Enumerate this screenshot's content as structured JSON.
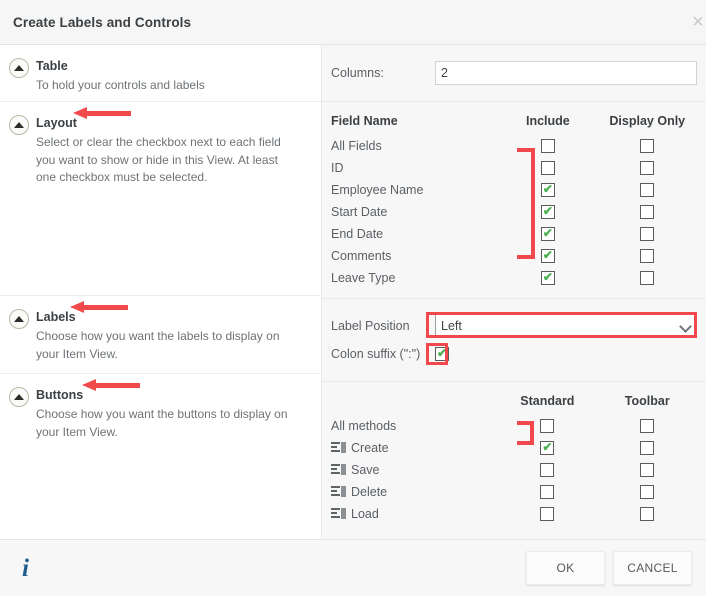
{
  "window": {
    "title": "Create Labels and Controls",
    "close_icon": "close-icon",
    "close_glyph": "×"
  },
  "sections": [
    {
      "key": "table",
      "title": "Table",
      "description": "To hold your controls and labels",
      "has_arrow": false,
      "collapse_icon": "collapse-up-icon"
    },
    {
      "key": "layout",
      "title": "Layout",
      "description": "Select or clear the checkbox next to each field you want to show or hide in this View. At least one checkbox must be selected.",
      "has_arrow": true,
      "collapse_icon": "collapse-up-icon"
    },
    {
      "key": "labels",
      "title": "Labels",
      "description": "Choose how you want the labels to display on your Item View.",
      "has_arrow": true,
      "collapse_icon": "collapse-up-icon"
    },
    {
      "key": "buttons",
      "title": "Buttons",
      "description": "Choose how you want the buttons to display on your Item View.",
      "has_arrow": true,
      "collapse_icon": "collapse-up-icon"
    }
  ],
  "table_panel": {
    "columns_label": "Columns:",
    "columns_value": "2",
    "columns_placeholder": ""
  },
  "layout_panel": {
    "headers": [
      "Field Name",
      "Include",
      "Display Only"
    ],
    "rows": [
      {
        "name": "All Fields",
        "include": false,
        "display_only": false
      },
      {
        "name": "ID",
        "include": false,
        "display_only": false
      },
      {
        "name": "Employee Name",
        "include": true,
        "display_only": false
      },
      {
        "name": "Start Date",
        "include": true,
        "display_only": false
      },
      {
        "name": "End Date",
        "include": true,
        "display_only": false
      },
      {
        "name": "Comments",
        "include": true,
        "display_only": false
      },
      {
        "name": "Leave Type",
        "include": true,
        "display_only": false
      }
    ]
  },
  "labels_panel": {
    "position_label": "Label Position",
    "position_value": "Left",
    "position_options": [
      "Left"
    ],
    "colon_label": "Colon suffix (\":\")",
    "colon_checked": true,
    "chevron_icon": "chevron-down-icon"
  },
  "buttons_panel": {
    "headers": [
      "",
      "Standard",
      "Toolbar"
    ],
    "rows": [
      {
        "name": "All methods",
        "icon": false,
        "standard": false,
        "toolbar": false
      },
      {
        "name": "Create",
        "icon": true,
        "standard": true,
        "toolbar": false
      },
      {
        "name": "Save",
        "icon": true,
        "standard": false,
        "toolbar": false
      },
      {
        "name": "Delete",
        "icon": true,
        "standard": false,
        "toolbar": false
      },
      {
        "name": "Load",
        "icon": true,
        "standard": false,
        "toolbar": false
      }
    ]
  },
  "footer": {
    "info_icon": "info-icon",
    "info_glyph": "i",
    "ok_label": "OK",
    "cancel_label": "CANCEL"
  },
  "colors": {
    "annotation_red": "#f0484c",
    "check_green": "#4caf50",
    "title_text": "#3b4044",
    "body_text": "#5b6065",
    "panel_bg": "#f7f7f7",
    "info_blue": "#1f5d8b"
  }
}
